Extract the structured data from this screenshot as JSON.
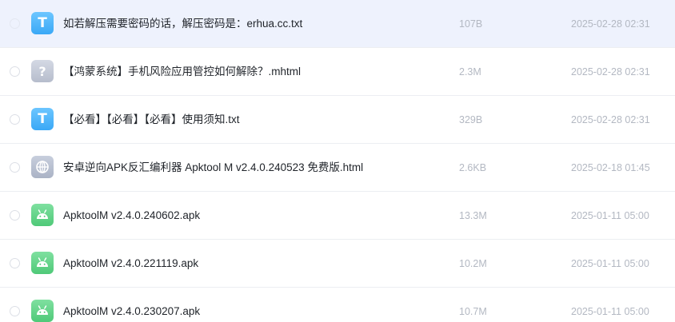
{
  "files": [
    {
      "icon": "txt-file-icon",
      "glyph": "T",
      "name": "如若解压需要密码的话，解压密码是：erhua.cc.txt",
      "size": "107B",
      "date": "2025-02-28 02:31"
    },
    {
      "icon": "unknown-file-icon",
      "glyph": "?",
      "name": "【鸿蒙系统】手机风险应用管控如何解除？.mhtml",
      "size": "2.3M",
      "date": "2025-02-28 02:31"
    },
    {
      "icon": "txt-file-icon",
      "glyph": "T",
      "name": "【必看】【必看】【必看】使用须知.txt",
      "size": "329B",
      "date": "2025-02-28 02:31"
    },
    {
      "icon": "html-file-icon",
      "glyph": "",
      "name": "安卓逆向APK反汇编利器 Apktool M v2.4.0.240523 免费版.html",
      "size": "2.6KB",
      "date": "2025-02-18 01:45"
    },
    {
      "icon": "apk-file-icon",
      "glyph": "",
      "name": "ApktoolM v2.4.0.240602.apk",
      "size": "13.3M",
      "date": "2025-01-11 05:00"
    },
    {
      "icon": "apk-file-icon",
      "glyph": "",
      "name": "ApktoolM v2.4.0.221119.apk",
      "size": "10.2M",
      "date": "2025-01-11 05:00"
    },
    {
      "icon": "apk-file-icon",
      "glyph": "",
      "name": "ApktoolM v2.4.0.230207.apk",
      "size": "10.7M",
      "date": "2025-01-11 05:00"
    }
  ],
  "colors": {
    "selected_row_bg": "#eef2fd",
    "txt_icon": "#3aa8f6",
    "apk_icon": "#4fc978",
    "unknown_icon": "#b6bdcc",
    "meta_text": "#b3b8c2"
  }
}
